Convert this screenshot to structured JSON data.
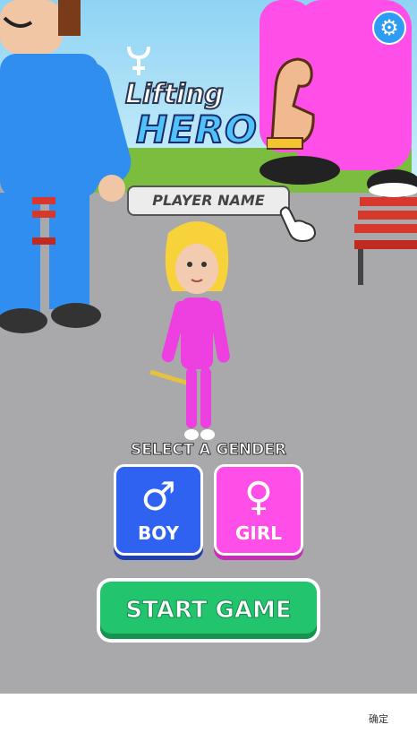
{
  "title": {
    "line1": "Lifting",
    "line2": "HERO"
  },
  "player_name_placeholder": "PLAYER NAME",
  "gender": {
    "label": "SELECT A GENDER",
    "boy": {
      "symbol": "♂",
      "label": "BOY",
      "color": "#2f62f0"
    },
    "girl": {
      "symbol": "♀",
      "label": "GIRL",
      "color": "#ff4fe8"
    }
  },
  "start_button": {
    "label": "START GAME",
    "color": "#22c56e"
  },
  "settings": {
    "icon": "gear-icon",
    "symbol": "⚙"
  },
  "system_bar": {
    "confirm_label": "确定"
  }
}
